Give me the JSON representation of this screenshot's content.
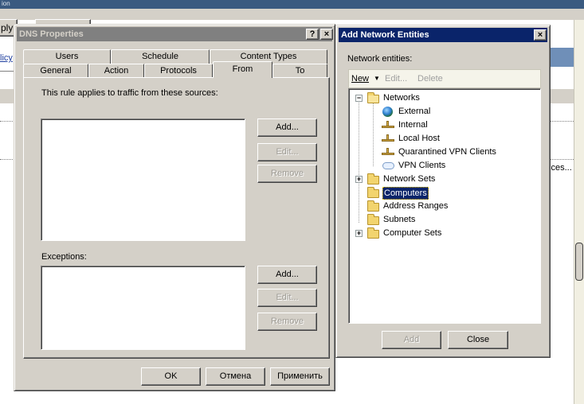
{
  "background_app": {
    "title_fragment": "ion",
    "apply_fragment": "ply",
    "policy_fragment": "licy",
    "truncated_text": "cces..."
  },
  "dns_dialog": {
    "title": "DNS Properties",
    "help_btn": "?",
    "close_btn": "×",
    "tabs_back": [
      "Users",
      "Schedule",
      "Content Types"
    ],
    "tabs_front": [
      "General",
      "Action",
      "Protocols",
      "From",
      "To"
    ],
    "selected_tab": "From",
    "sources_label": "This rule applies to traffic from these sources:",
    "exceptions_label": "Exceptions:",
    "add_label": "Add...",
    "edit_label": "Edit...",
    "remove_label": "Remove",
    "ok_label": "OK",
    "cancel_label": "Отмена",
    "apply_label": "Применить"
  },
  "net_dialog": {
    "title": "Add Network Entities",
    "close_btn": "×",
    "entities_label": "Network entities:",
    "toolbar": {
      "new_label": "New",
      "edit_label": "Edit...",
      "delete_label": "Delete"
    },
    "tree": {
      "networks": "Networks",
      "network_children": [
        {
          "label": "External",
          "icon": "globe-icon"
        },
        {
          "label": "Internal",
          "icon": "network-node-icon"
        },
        {
          "label": "Local Host",
          "icon": "network-node-icon"
        },
        {
          "label": "Quarantined VPN Clients",
          "icon": "network-node-icon"
        },
        {
          "label": "VPN Clients",
          "icon": "cloud-icon"
        }
      ],
      "network_sets": "Network Sets",
      "computers": "Computers",
      "address_ranges": "Address Ranges",
      "subnets": "Subnets",
      "computer_sets": "Computer Sets"
    },
    "add_label": "Add",
    "close_label": "Close"
  },
  "colors": {
    "active_title": "#0a246a",
    "inactive_title": "#808080",
    "dialog_face": "#d4d0c8"
  }
}
